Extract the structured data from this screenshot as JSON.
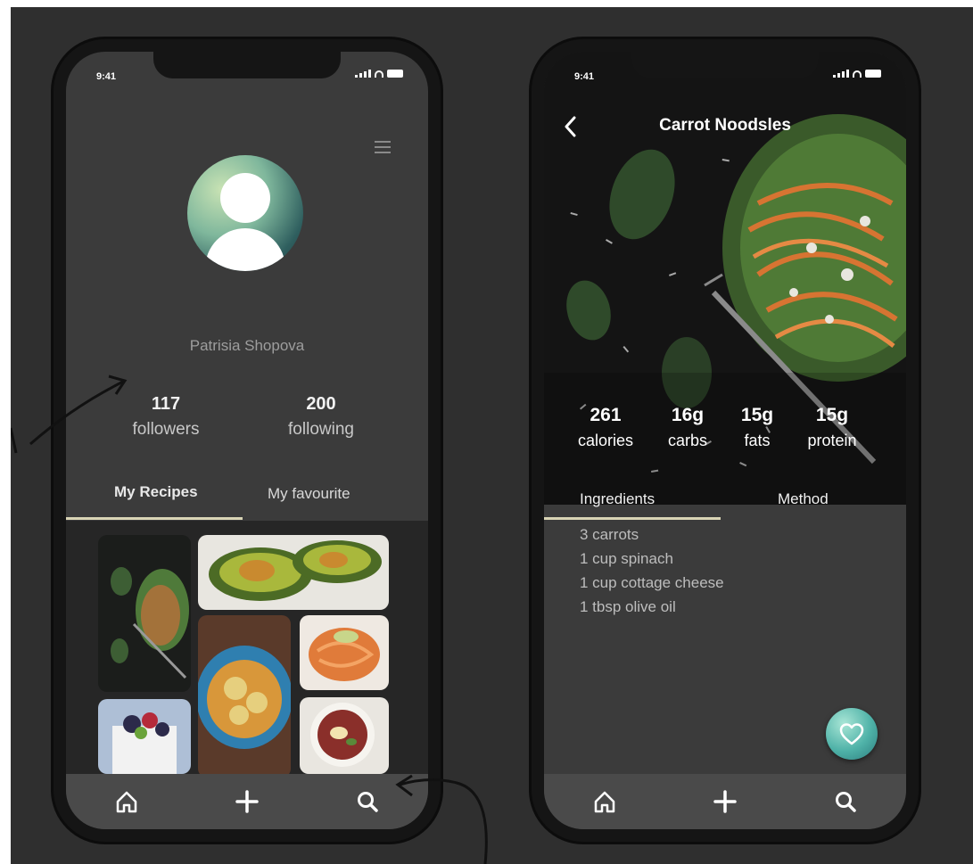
{
  "profile_screen": {
    "status_time": "9:41",
    "user_name": "Patrisia Shopova",
    "stats": [
      {
        "value": "117",
        "label": "followers"
      },
      {
        "value": "200",
        "label": "following"
      }
    ],
    "tabs": [
      {
        "label": "My Recipes",
        "active": true
      },
      {
        "label": "My favourite",
        "active": false
      }
    ],
    "nav": [
      "home-icon",
      "plus-icon",
      "search-icon"
    ]
  },
  "recipe_screen": {
    "status_time": "9:41",
    "title": "Carrot Noodsles",
    "nutrition": [
      {
        "value": "261",
        "label": "calories"
      },
      {
        "value": "16g",
        "label": "carbs"
      },
      {
        "value": "15g",
        "label": "fats"
      },
      {
        "value": "15g",
        "label": "protein"
      }
    ],
    "tabs": [
      {
        "label": "Ingredients",
        "active": true
      },
      {
        "label": "Method",
        "active": false
      }
    ],
    "ingredients": [
      "3 carrots",
      "1 cup spinach",
      "1 cup cottage cheese",
      "1 tbsp olive oil"
    ],
    "nav": [
      "home-icon",
      "plus-icon",
      "search-icon"
    ]
  },
  "colors": {
    "background": "#2f2f2f",
    "phone_frame": "#151515",
    "screen": "#3b3b3b",
    "accent_underline": "#d9d4b5",
    "favorite_button": "#4fb2a8"
  }
}
